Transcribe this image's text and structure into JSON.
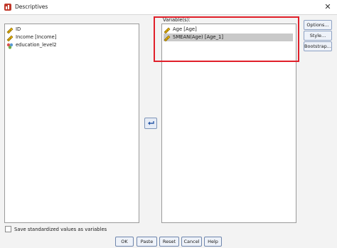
{
  "window": {
    "title": "Descriptives"
  },
  "source_list": {
    "items": [
      {
        "label": "ID",
        "icon": "scale-ruler-icon"
      },
      {
        "label": "Income [Income]",
        "icon": "scale-ruler-icon"
      },
      {
        "label": "education_level2",
        "icon": "nominal-icon"
      }
    ]
  },
  "target": {
    "label": "Variable(s):",
    "items": [
      {
        "label": "Age [Age]",
        "icon": "scale-ruler-icon",
        "selected": false
      },
      {
        "label": "SMEAN(Age) [Age_1]",
        "icon": "scale-ruler-icon",
        "selected": true
      }
    ]
  },
  "side_buttons": {
    "options": "Options...",
    "style": "Style...",
    "bootstrap": "Bootstrap..."
  },
  "checkbox": {
    "label": "Save standardized values as variables",
    "checked": false
  },
  "buttons": {
    "ok": "OK",
    "paste": "Paste",
    "reset": "Reset",
    "cancel": "Cancel",
    "help": "Help"
  },
  "colors": {
    "highlight": "#e0202a",
    "selected_row": "#c9c9c9",
    "button_face": "#eef2f9"
  }
}
